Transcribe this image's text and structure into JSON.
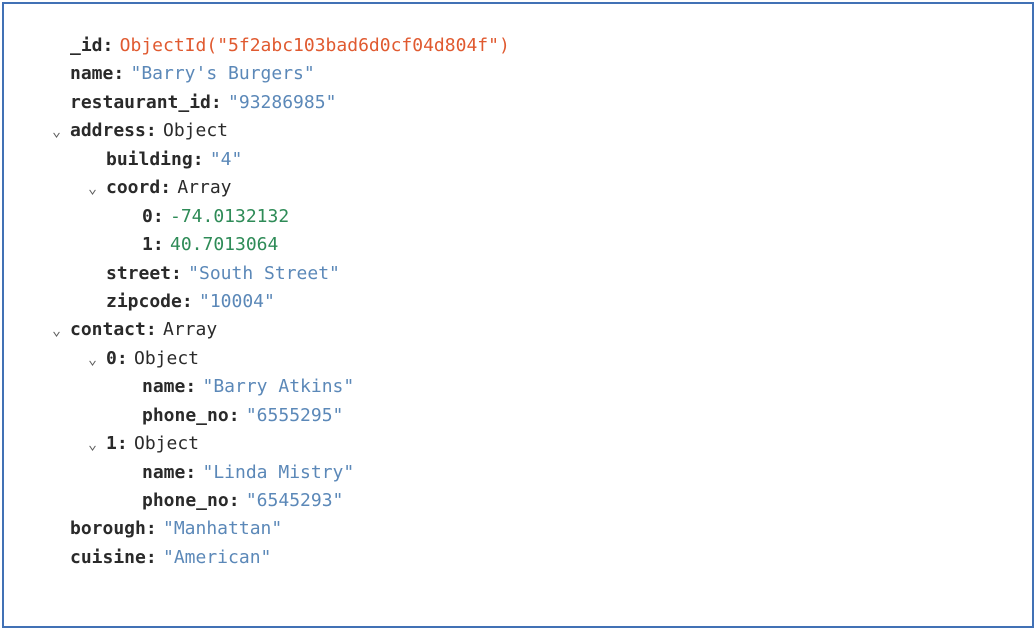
{
  "doc": {
    "id_key": "_id",
    "id_val": "ObjectId(\"5f2abc103bad6d0cf04d804f\")",
    "name_key": "name",
    "name_val": "\"Barry's Burgers\"",
    "rid_key": "restaurant_id",
    "rid_val": "\"93286985\"",
    "address_key": "address",
    "address_type": "Object",
    "building_key": "building",
    "building_val": "\"4\"",
    "coord_key": "coord",
    "coord_type": "Array",
    "coord_0_key": "0",
    "coord_0_val": "-74.0132132",
    "coord_1_key": "1",
    "coord_1_val": "40.7013064",
    "street_key": "street",
    "street_val": "\"South Street\"",
    "zipcode_key": "zipcode",
    "zipcode_val": "\"10004\"",
    "contact_key": "contact",
    "contact_type": "Array",
    "c0_key": "0",
    "c0_type": "Object",
    "c0_name_key": "name",
    "c0_name_val": "\"Barry Atkins\"",
    "c0_phone_key": "phone_no",
    "c0_phone_val": "\"6555295\"",
    "c1_key": "1",
    "c1_type": "Object",
    "c1_name_key": "name",
    "c1_name_val": "\"Linda Mistry\"",
    "c1_phone_key": "phone_no",
    "c1_phone_val": "\"6545293\"",
    "borough_key": "borough",
    "borough_val": "\"Manhattan\"",
    "cuisine_key": "cuisine",
    "cuisine_val": "\"American\""
  }
}
